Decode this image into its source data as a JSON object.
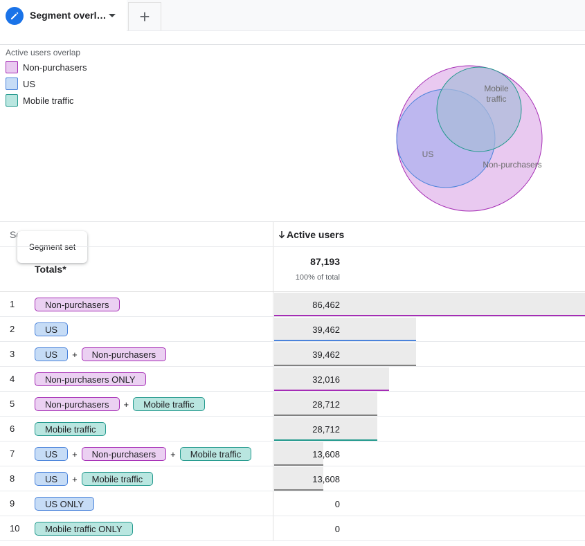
{
  "tab": {
    "label": "Segment overl…",
    "add_label": "+"
  },
  "legend": {
    "title": "Active users overlap",
    "items": [
      {
        "label": "Non-purchasers",
        "color": "#e9caf0",
        "border": "#a52cb5"
      },
      {
        "label": "US",
        "color": "#c6dcf6",
        "border": "#4a83db"
      },
      {
        "label": "Mobile traffic",
        "color": "#b9e6e0",
        "border": "#22998d"
      }
    ]
  },
  "venn": {
    "labels": {
      "mobile_line1": "Mobile",
      "mobile_line2": "traffic",
      "us": "US",
      "non_purchasers": "Non-purchasers"
    }
  },
  "table": {
    "segment_header": "Segment set",
    "metric_header": "Active users",
    "tooltip": "Segment set",
    "totals_label": "Totals*",
    "totals_value": "87,193",
    "totals_pct": "100% of total",
    "max_value": 86462,
    "rows": [
      {
        "num": "1",
        "chips": [
          {
            "label": "Non-purchasers",
            "kind": "np"
          }
        ],
        "value": "86,462",
        "raw": 86462,
        "line": "#a52cb5"
      },
      {
        "num": "2",
        "chips": [
          {
            "label": "US",
            "kind": "us"
          }
        ],
        "value": "39,462",
        "raw": 39462,
        "line": "#4a83db"
      },
      {
        "num": "3",
        "chips": [
          {
            "label": "US",
            "kind": "us"
          },
          {
            "label": "Non-purchasers",
            "kind": "np"
          }
        ],
        "value": "39,462",
        "raw": 39462,
        "line": "#808080"
      },
      {
        "num": "4",
        "chips": [
          {
            "label": "Non-purchasers ONLY",
            "kind": "np"
          }
        ],
        "value": "32,016",
        "raw": 32016,
        "line": "#a52cb5"
      },
      {
        "num": "5",
        "chips": [
          {
            "label": "Non-purchasers",
            "kind": "np"
          },
          {
            "label": "Mobile traffic",
            "kind": "mt"
          }
        ],
        "value": "28,712",
        "raw": 28712,
        "line": "#808080"
      },
      {
        "num": "6",
        "chips": [
          {
            "label": "Mobile traffic",
            "kind": "mt"
          }
        ],
        "value": "28,712",
        "raw": 28712,
        "line": "#22998d"
      },
      {
        "num": "7",
        "chips": [
          {
            "label": "US",
            "kind": "us"
          },
          {
            "label": "Non-purchasers",
            "kind": "np"
          },
          {
            "label": "Mobile traffic",
            "kind": "mt"
          }
        ],
        "value": "13,608",
        "raw": 13608,
        "line": "#808080"
      },
      {
        "num": "8",
        "chips": [
          {
            "label": "US",
            "kind": "us"
          },
          {
            "label": "Mobile traffic",
            "kind": "mt"
          }
        ],
        "value": "13,608",
        "raw": 13608,
        "line": "#808080"
      },
      {
        "num": "9",
        "chips": [
          {
            "label": "US ONLY",
            "kind": "us"
          }
        ],
        "value": "0",
        "raw": 0,
        "line": ""
      },
      {
        "num": "10",
        "chips": [
          {
            "label": "Mobile traffic ONLY",
            "kind": "mt"
          }
        ],
        "value": "0",
        "raw": 0,
        "line": ""
      }
    ]
  }
}
